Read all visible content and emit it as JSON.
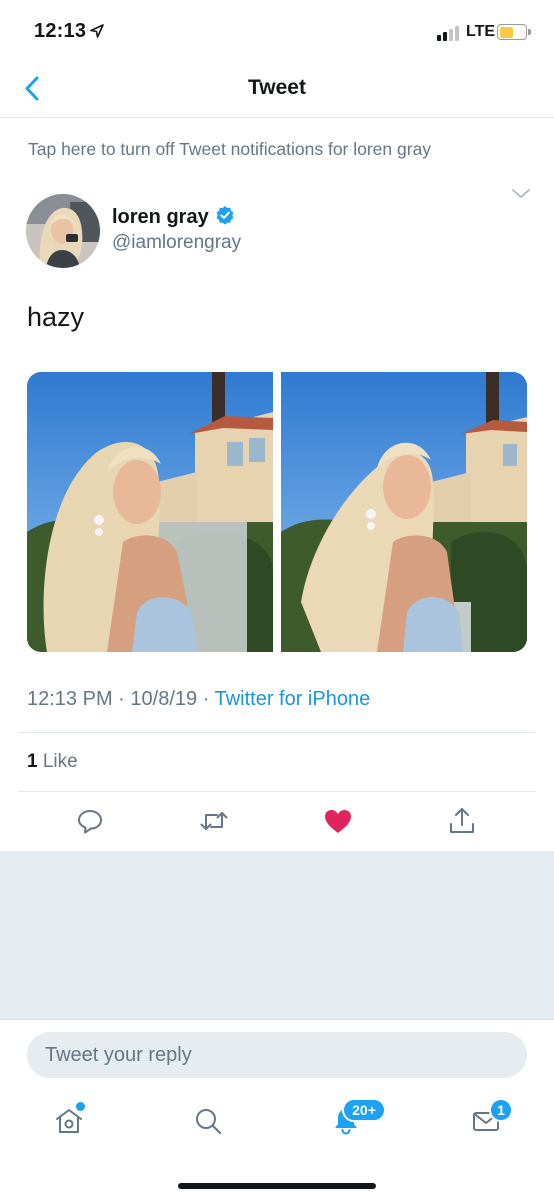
{
  "status_bar": {
    "time": "12:13",
    "network": "LTE",
    "battery_color": "#f7c945"
  },
  "nav": {
    "title": "Tweet",
    "back_icon": "chevron-left-icon"
  },
  "notification_banner": "Tap here to turn off Tweet notifications for loren gray",
  "tweet": {
    "author_name": "loren gray",
    "author_handle": "@iamlorengray",
    "verified": true,
    "text": "hazy",
    "images": [
      "photo",
      "photo"
    ],
    "time": "12:13 PM",
    "separator": "·",
    "date": "10/8/19",
    "source": "Twitter for iPhone",
    "like_count": "1",
    "like_label": "Like"
  },
  "actions": [
    "reply-icon",
    "retweet-icon",
    "heart-icon",
    "share-icon"
  ],
  "reply": {
    "placeholder": "Tweet your reply"
  },
  "tab_bar": {
    "tabs": [
      "home-icon",
      "search-icon",
      "notifications-icon",
      "messages-icon"
    ],
    "notifications_badge": "20+",
    "messages_badge": "1"
  },
  "colors": {
    "accent": "#1da1f2",
    "link": "#1b95e0",
    "like": "#e0245e",
    "secondary_text": "#657786"
  }
}
